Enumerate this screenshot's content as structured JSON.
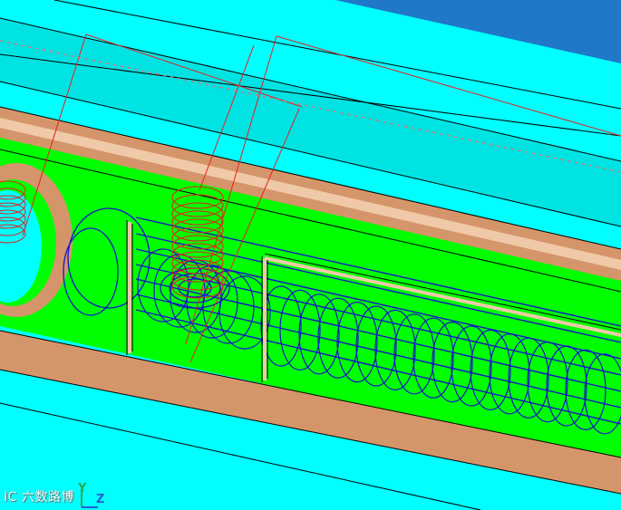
{
  "viewport": {
    "watermark_text": "IC  六数路博",
    "axis_y_label": "Y",
    "axis_z_label": "Z"
  },
  "colors": {
    "background": "#00ffff",
    "wall": "#00e8e8",
    "pocket_floor": "#00ff00",
    "rim": "#d5956a",
    "rim_light": "#f0c9a8",
    "toolpath": "#1414c8",
    "plunge": "#e62020",
    "edge": "#000000",
    "corner": "#1f78c8"
  },
  "icons": [
    "axis-triad-icon"
  ]
}
